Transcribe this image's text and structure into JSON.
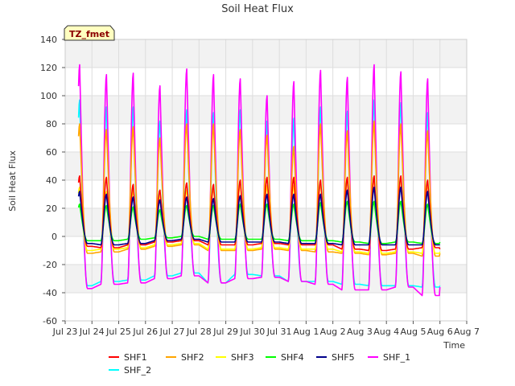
{
  "chart_data": {
    "type": "line",
    "title": "Soil Heat Flux",
    "xlabel": "Time",
    "ylabel": "Soil Heat Flux",
    "badge": "TZ_fmet",
    "ylim": [
      -60,
      140
    ],
    "yticks": [
      -60,
      -40,
      -20,
      0,
      20,
      40,
      60,
      80,
      100,
      120,
      140
    ],
    "xlim": [
      "2024-07-23",
      "2024-08-07"
    ],
    "xtick_labels": [
      "Jul 23",
      "Jul 24",
      "Jul 25",
      "Jul 26",
      "Jul 27",
      "Jul 28",
      "Jul 29",
      "Jul 30",
      "Jul 31",
      "Aug 1",
      "Aug 2",
      "Aug 3",
      "Aug 4",
      "Aug 5",
      "Aug 6",
      "Aug 7"
    ],
    "data_start": "2024-07-23 12:00",
    "data_end": "2024-08-06 00:00",
    "peak_hour_of_day": 13,
    "grid": true,
    "legend_position": "bottom",
    "days": [
      "Jul 23",
      "Jul 24",
      "Jul 25",
      "Jul 26",
      "Jul 27",
      "Jul 28",
      "Jul 29",
      "Jul 30",
      "Jul 31",
      "Aug 1",
      "Aug 2",
      "Aug 3",
      "Aug 4",
      "Aug 5"
    ],
    "series": [
      {
        "name": "SHF1",
        "color": "#ff0000",
        "daily_max": [
          43,
          42,
          37,
          33,
          38,
          37,
          40,
          42,
          42,
          40,
          42,
          43,
          43,
          40
        ],
        "daily_min": [
          -7,
          -8,
          -6,
          -4,
          -3,
          -6,
          -6,
          -5,
          -6,
          -6,
          -9,
          -10,
          -9,
          -8
        ]
      },
      {
        "name": "SHF2",
        "color": "#ffa500",
        "daily_max": [
          80,
          76,
          78,
          70,
          80,
          80,
          76,
          72,
          64,
          80,
          75,
          82,
          80,
          75
        ],
        "daily_min": [
          -12,
          -11,
          -9,
          -7,
          -6,
          -10,
          -10,
          -9,
          -10,
          -11,
          -12,
          -13,
          -12,
          -14
        ]
      },
      {
        "name": "SHF3",
        "color": "#ffff00",
        "daily_max": [
          35,
          32,
          33,
          30,
          33,
          35,
          38,
          36,
          36,
          38,
          40,
          42,
          42,
          38
        ],
        "daily_min": [
          -10,
          -9,
          -8,
          -6,
          -5,
          -9,
          -9,
          -8,
          -9,
          -9,
          -11,
          -12,
          -11,
          -12
        ]
      },
      {
        "name": "SHF4",
        "color": "#00ff00",
        "daily_max": [
          23,
          22,
          21,
          19,
          22,
          22,
          23,
          23,
          23,
          24,
          25,
          25,
          25,
          23
        ],
        "daily_min": [
          -3,
          -3,
          -2,
          -1,
          0,
          -2,
          -2,
          -2,
          -3,
          -3,
          -4,
          -5,
          -4,
          -5
        ]
      },
      {
        "name": "SHF5",
        "color": "#00008b",
        "daily_max": [
          32,
          30,
          28,
          26,
          28,
          27,
          29,
          30,
          30,
          30,
          33,
          35,
          35,
          32
        ],
        "daily_min": [
          -5,
          -6,
          -5,
          -3,
          -2,
          -4,
          -4,
          -4,
          -5,
          -5,
          -6,
          -6,
          -6,
          -6
        ]
      },
      {
        "name": "SHF_1",
        "color": "#ff00ff",
        "daily_max": [
          122,
          115,
          116,
          107,
          119,
          115,
          112,
          100,
          110,
          118,
          113,
          122,
          117,
          112
        ],
        "daily_min": [
          -37,
          -34,
          -33,
          -30,
          -28,
          -33,
          -30,
          -29,
          -32,
          -34,
          -38,
          -38,
          -36,
          -42
        ]
      },
      {
        "name": "SHF_2",
        "color": "#00ffff",
        "daily_max": [
          97,
          92,
          92,
          82,
          90,
          88,
          90,
          82,
          84,
          92,
          89,
          97,
          95,
          88
        ],
        "daily_min": [
          -35,
          -32,
          -31,
          -28,
          -26,
          -33,
          -27,
          -28,
          -32,
          -32,
          -34,
          -35,
          -35,
          -36
        ]
      }
    ]
  }
}
